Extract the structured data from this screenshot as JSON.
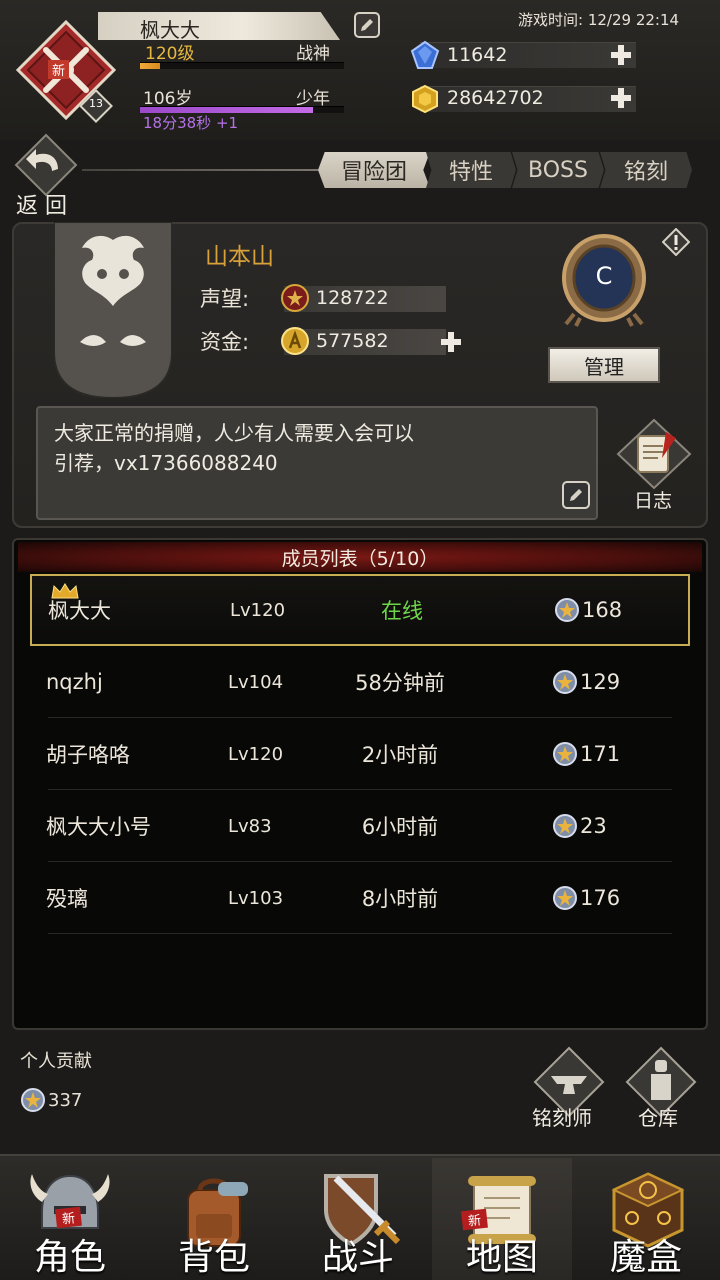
{
  "player": {
    "name": "枫大大",
    "new_badge": "新",
    "rank_number": "13",
    "level": "120级",
    "title": "战神",
    "level_progress": 0.1,
    "age": "106岁",
    "stage": "少年",
    "age_progress": 0.85,
    "timer": "18分38秒 +1"
  },
  "game_time": "游戏时间: 12/29 22:14",
  "resources": {
    "gems": "11642",
    "gold": "28642702"
  },
  "nav_back": {
    "label": "返 回"
  },
  "tabs": [
    "冒险团",
    "特性",
    "BOSS",
    "铭刻"
  ],
  "guild": {
    "name": "山本山",
    "emblem_letter": "C",
    "reputation_label": "声望:",
    "reputation_value": "128722",
    "funds_label": "资金:",
    "funds_value": "577582",
    "manage_label": "管理",
    "notice_line1": "大家正常的捐赠，人少有人需要入会可以",
    "notice_line2": "引荐，vx17366088240",
    "log_label": "日志"
  },
  "members": {
    "header": "成员列表（5/10）",
    "rows": [
      {
        "name": "枫大大",
        "level": "Lv120",
        "status": "在线",
        "points": "168"
      },
      {
        "name": "nqzhj",
        "level": "Lv104",
        "status": "58分钟前",
        "points": "129"
      },
      {
        "name": "胡子咯咯",
        "level": "Lv120",
        "status": "2小时前",
        "points": "171"
      },
      {
        "name": "枫大大小号",
        "level": "Lv83",
        "status": "6小时前",
        "points": "23"
      },
      {
        "name": "殁璃",
        "level": "Lv103",
        "status": "8小时前",
        "points": "176"
      }
    ]
  },
  "contribution": {
    "label": "个人贡献",
    "value": "337"
  },
  "side_buttons": {
    "engraver": "铭刻师",
    "warehouse": "仓库"
  },
  "bottom_nav": [
    "角色",
    "背包",
    "战斗",
    "地图",
    "魔盒"
  ],
  "colors": {
    "accent_gold": "#d9a13a",
    "online": "#6fd64a",
    "timer": "#b572e6",
    "member_header": "#7a1814"
  }
}
